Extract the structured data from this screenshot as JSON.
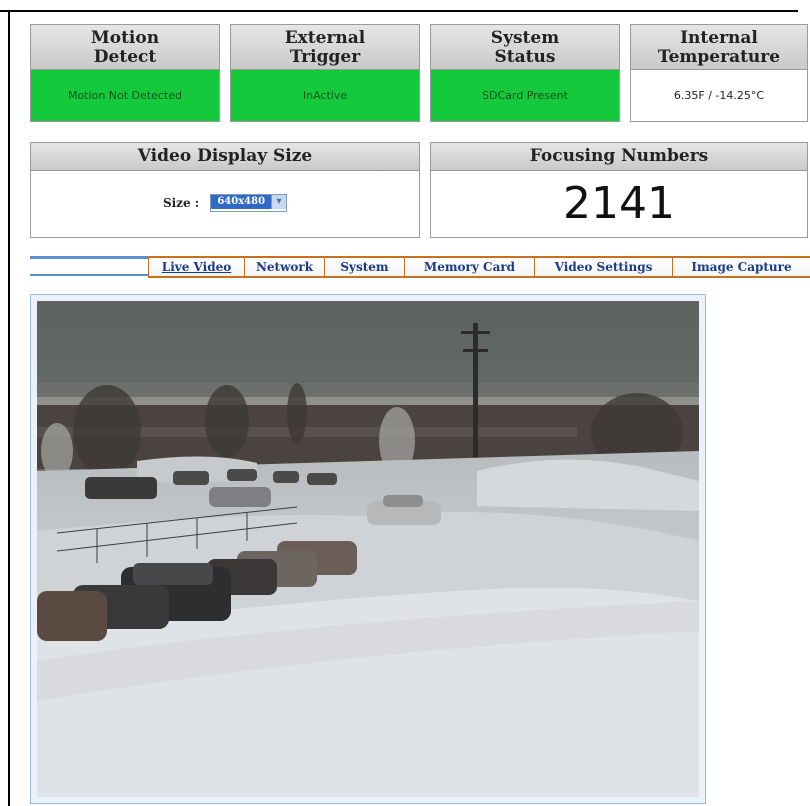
{
  "status_panels": [
    {
      "title": "Motion\nDetect",
      "line1": "Motion",
      "line2": "Detect",
      "value": "Motion Not Detected"
    },
    {
      "line1": "External",
      "line2": "Trigger",
      "value": "InActive"
    },
    {
      "line1": "System",
      "line2": "Status",
      "value": "SDCard Present"
    },
    {
      "line1": "Internal",
      "line2": "Temperature",
      "value": "6.35F / -14.25°C"
    }
  ],
  "video_display": {
    "title": "Video Display Size",
    "size_label": "Size :",
    "size_value": "640x480"
  },
  "focusing": {
    "title": "Focusing Numbers",
    "value": "2141"
  },
  "nav": [
    "Live Video",
    "Network",
    "System",
    "Memory Card",
    "Video Settings",
    "Image Capture"
  ],
  "colors": {
    "status_green": "#14c93c",
    "nav_border": "#c7711e",
    "nav_text": "#1a3a8a",
    "blue_accent": "#5b8fd0"
  }
}
